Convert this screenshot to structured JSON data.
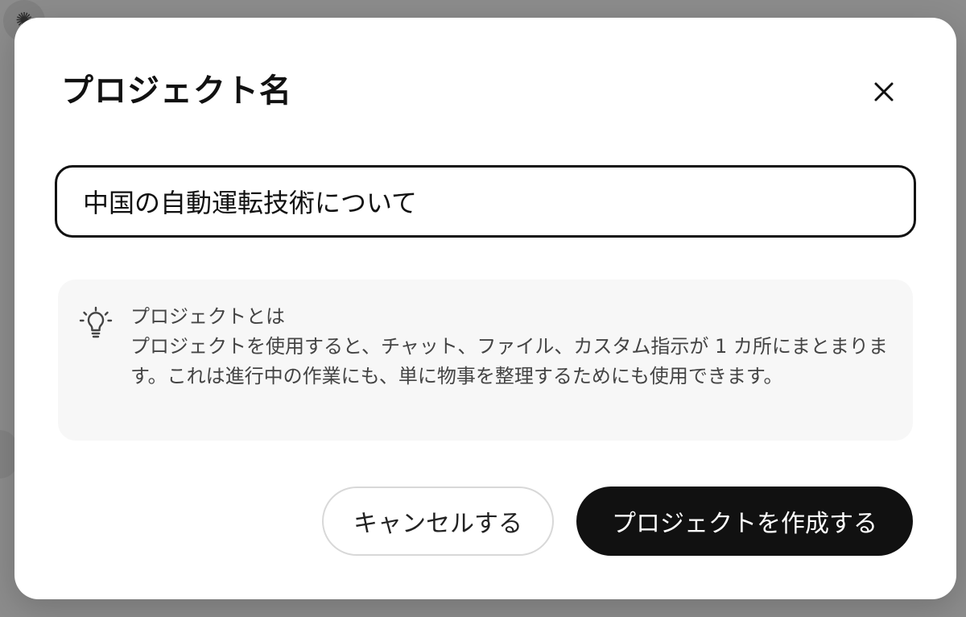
{
  "modal": {
    "title": "プロジェクト名",
    "name_input_value": "中国の自動運転技術について",
    "info": {
      "title": "プロジェクトとは",
      "body": "プロジェクトを使用すると、チャット、ファイル、カスタム指示が 1 カ所にまとまります。これは進行中の作業にも、単に物事を整理するためにも使用できます。"
    },
    "cancel_label": "キャンセルする",
    "create_label": "プロジェクトを作成する"
  },
  "icons": {
    "close": "close-icon",
    "info": "lightbulb-icon"
  },
  "colors": {
    "primary_button": "#111111",
    "primary_button_text": "#ffffff",
    "info_background": "#f7f7f7"
  }
}
